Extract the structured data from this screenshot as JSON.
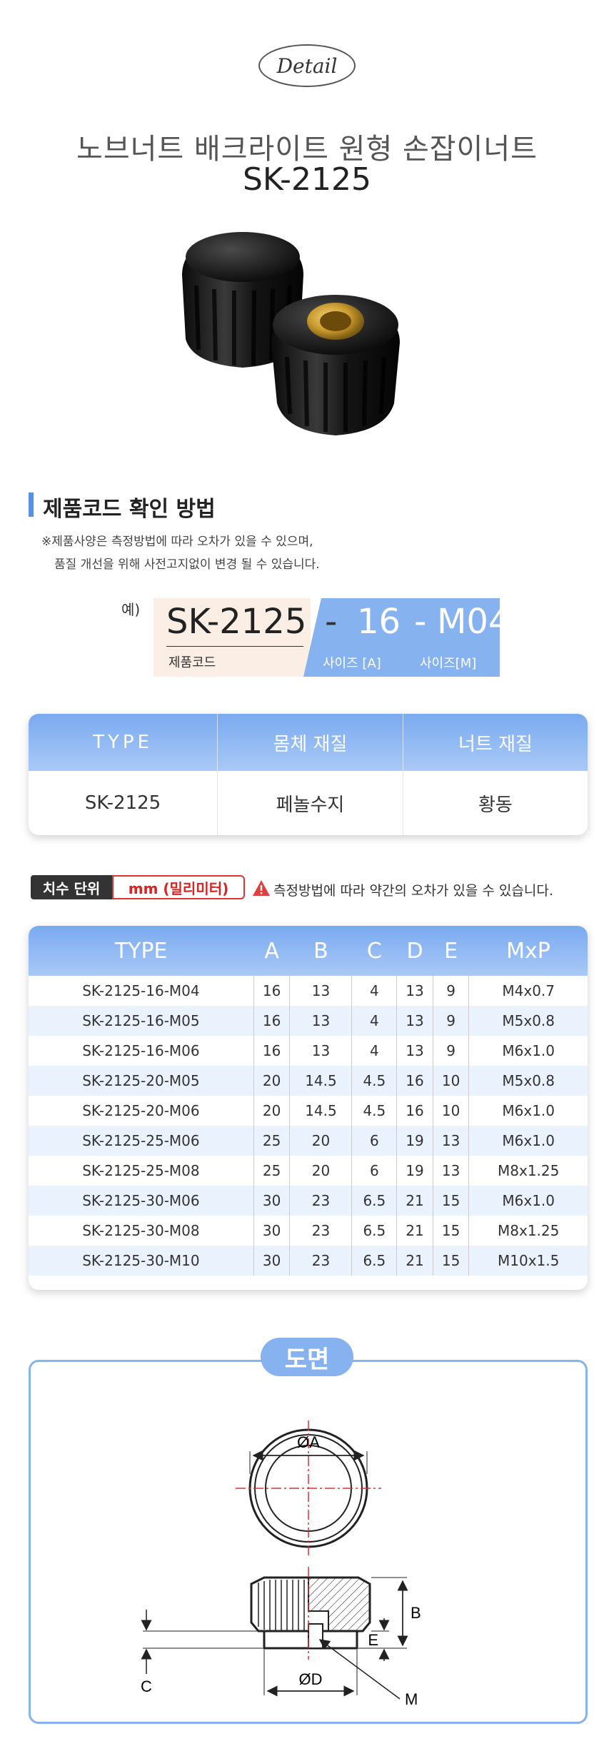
{
  "header": {
    "logo": "Detail",
    "title": "노브너트 배크라이트 원형 손잡이너트",
    "model": "SK-2125"
  },
  "section": {
    "title": "제품코드 확인 방법",
    "note_line1": "※제품사양은 측정방법에 따라 오차가 있을  수 있으며,",
    "note_line2": "품질 개선을 위해 사전고지없이 변경 될 수 있습니다."
  },
  "example": {
    "label": "예)",
    "code": "SK-2125",
    "code_caption": "제품코드",
    "dash": "-",
    "size": "16",
    "thread": "M04",
    "size_caption": "사이즈 [A]",
    "thread_caption": "사이즈[M]"
  },
  "material_table": {
    "headers": [
      "TYPE",
      "몸체 재질",
      "너트 재질"
    ],
    "row": [
      "SK-2125",
      "페놀수지",
      "황동"
    ]
  },
  "unit": {
    "badge": "치수 단위",
    "mm": "mm (밀리미터)",
    "warning": "측정방법에 따라 약간의 오차가 있을 수 있습니다."
  },
  "dimension_table": {
    "headers": [
      "TYPE",
      "A",
      "B",
      "C",
      "D",
      "E",
      "MxP"
    ],
    "rows": [
      [
        "SK-2125-16-M04",
        "16",
        "13",
        "4",
        "13",
        "9",
        "M4x0.7"
      ],
      [
        "SK-2125-16-M05",
        "16",
        "13",
        "4",
        "13",
        "9",
        "M5x0.8"
      ],
      [
        "SK-2125-16-M06",
        "16",
        "13",
        "4",
        "13",
        "9",
        "M6x1.0"
      ],
      [
        "SK-2125-20-M05",
        "20",
        "14.5",
        "4.5",
        "16",
        "10",
        "M5x0.8"
      ],
      [
        "SK-2125-20-M06",
        "20",
        "14.5",
        "4.5",
        "16",
        "10",
        "M6x1.0"
      ],
      [
        "SK-2125-25-M06",
        "25",
        "20",
        "6",
        "19",
        "13",
        "M6x1.0"
      ],
      [
        "SK-2125-25-M08",
        "25",
        "20",
        "6",
        "19",
        "13",
        "M8x1.25"
      ],
      [
        "SK-2125-30-M06",
        "30",
        "23",
        "6.5",
        "21",
        "15",
        "M6x1.0"
      ],
      [
        "SK-2125-30-M08",
        "30",
        "23",
        "6.5",
        "21",
        "15",
        "M8x1.25"
      ],
      [
        "SK-2125-30-M10",
        "30",
        "23",
        "6.5",
        "21",
        "15",
        "M10x1.5"
      ]
    ]
  },
  "drawing": {
    "badge": "도면",
    "label_a": "ØA",
    "label_b": "B",
    "label_c": "C",
    "label_d": "ØD",
    "label_e": "E",
    "label_m": "M"
  },
  "colors": {
    "accent_blue": "#86b2f0",
    "warning_red": "#d33333",
    "code_bg": "#fbeee4"
  }
}
